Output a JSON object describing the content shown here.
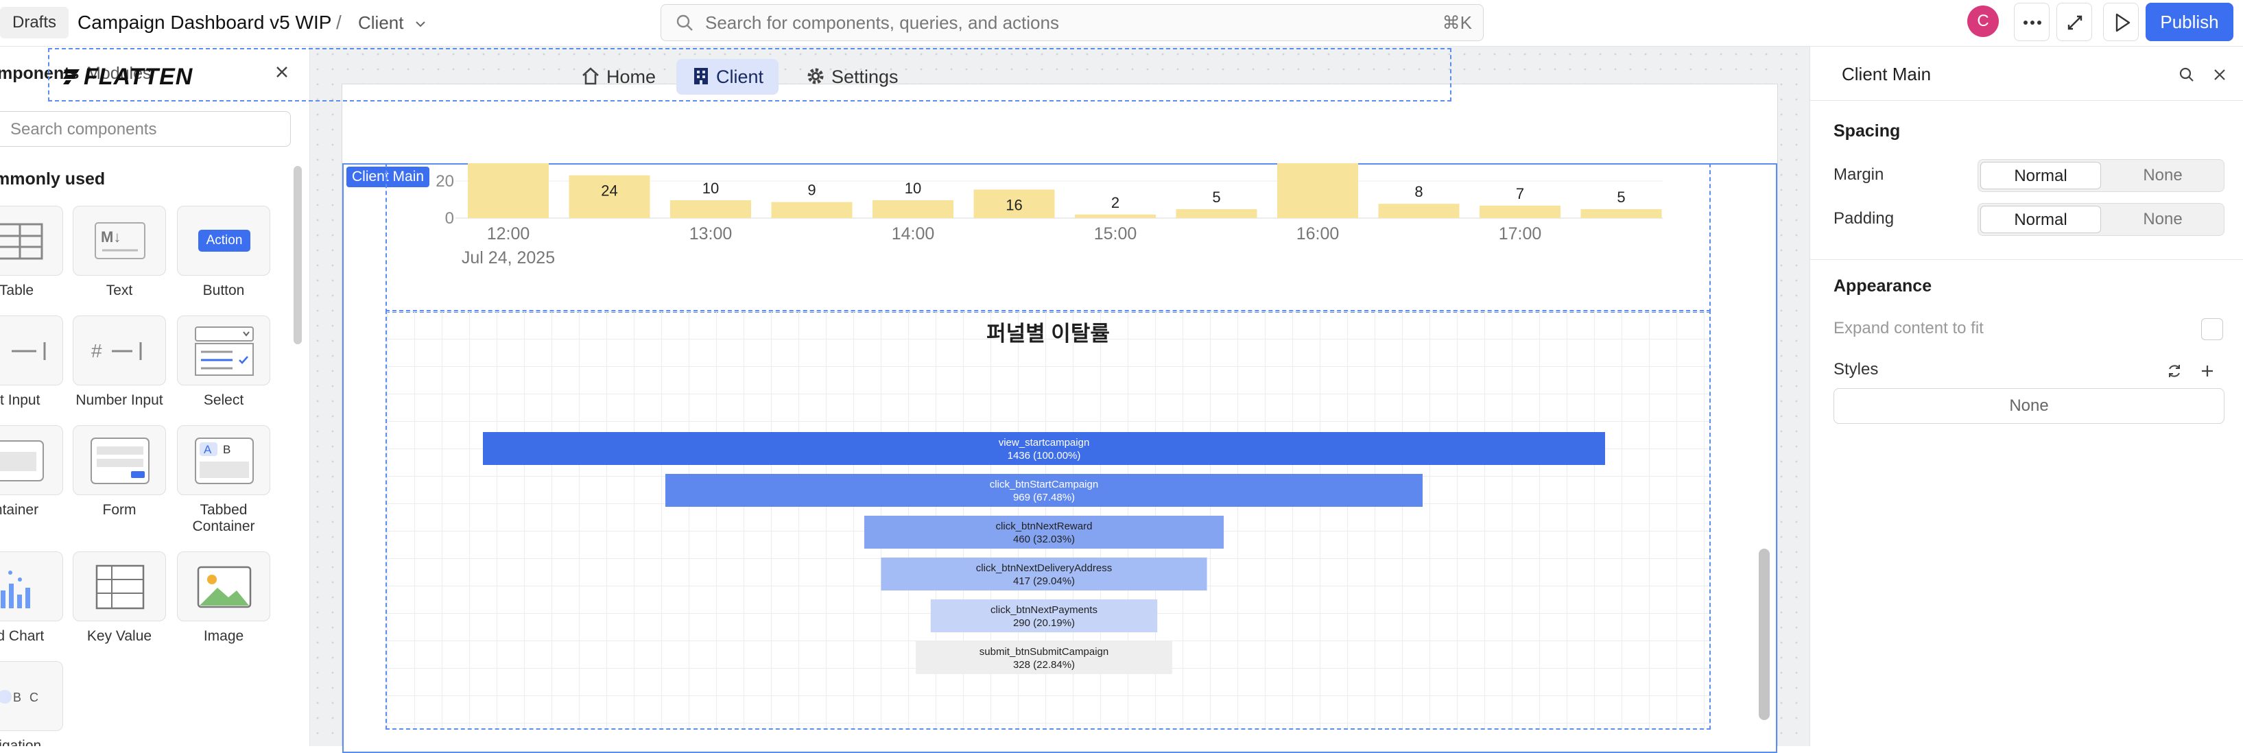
{
  "topbar": {
    "drafts": "Drafts",
    "app_name": "Campaign Dashboard v5 WIP",
    "separator": "/",
    "page": "Client",
    "search_placeholder": "Search for components, queries, and actions",
    "search_shortcut": "⌘K",
    "avatar_initial": "C",
    "publish": "Publish"
  },
  "left_panel": {
    "tabs": [
      "mponents",
      "Modules"
    ],
    "search_placeholder": "Search components",
    "section": "mmonly used",
    "components": [
      {
        "label": "Table",
        "icon": "table-icon"
      },
      {
        "label": "Text",
        "icon": "markdown-text-icon"
      },
      {
        "label": "Button",
        "icon": "button-icon",
        "badge": "Action"
      },
      {
        "label": "xt Input",
        "icon": "text-input-icon"
      },
      {
        "label": "Number Input",
        "icon": "number-input-icon"
      },
      {
        "label": "Select",
        "icon": "select-icon"
      },
      {
        "label": "ntainer",
        "icon": "container-icon"
      },
      {
        "label": "Form",
        "icon": "form-icon"
      },
      {
        "label": "Tabbed Container",
        "icon": "tabbed-container-icon",
        "badge_a": "A",
        "badge_b": "B"
      },
      {
        "label": "ed Chart",
        "icon": "chart-icon"
      },
      {
        "label": "Key Value",
        "icon": "key-value-icon"
      },
      {
        "label": "Image",
        "icon": "image-icon"
      },
      {
        "label": "vigation",
        "icon": "navigation-icon",
        "badge_b": "B",
        "badge_c": "C"
      }
    ]
  },
  "app_header": {
    "logo": "FLATTEN",
    "nav": [
      {
        "label": "Home",
        "icon": "home-icon"
      },
      {
        "label": "Client",
        "icon": "building-icon",
        "active": true
      },
      {
        "label": "Settings",
        "icon": "gear-icon"
      }
    ]
  },
  "main_badge": "Client Main",
  "funnel_title": "퍼널별 이탈률",
  "chart_data": [
    {
      "type": "bar",
      "y_tick_labels": [
        "20",
        "0"
      ],
      "x_tick_labels": [
        "12:00",
        "13:00",
        "14:00",
        "15:00",
        "16:00",
        "17:00"
      ],
      "x_sub_label": "Jul 24, 2025",
      "values": [
        null,
        24,
        10,
        9,
        10,
        16,
        2,
        5,
        null,
        8,
        7,
        5
      ],
      "data_labels": [
        "",
        "24",
        "10",
        "9",
        "10",
        "16",
        "2",
        "5",
        "",
        "8",
        "7",
        "5"
      ],
      "bar_color": "#f7e39a",
      "note": "first and ninth bars extend above visible area (clipped)"
    },
    {
      "type": "funnel",
      "title": "퍼널별 이탈률",
      "stages": [
        {
          "name": "view_startcampaign",
          "value": 1436,
          "label": "1436 (100.00%)",
          "color": "#3d6ee8"
        },
        {
          "name": "click_btnStartCampaign",
          "value": 969,
          "label": "969 (67.48%)",
          "color": "#5f88ee"
        },
        {
          "name": "click_btnNextReward",
          "value": 460,
          "label": "460 (32.03%)",
          "color": "#84a4f2"
        },
        {
          "name": "click_btnNextDeliveryAddress",
          "value": 417,
          "label": "417 (29.04%)",
          "color": "#a4bcf5"
        },
        {
          "name": "click_btnNextPayments",
          "value": 290,
          "label": "290 (20.19%)",
          "color": "#c6d4f8"
        },
        {
          "name": "submit_btnSubmitCampaign",
          "value": 328,
          "label": "328 (22.84%)",
          "color": "#eeeeee"
        }
      ]
    }
  ],
  "right_panel": {
    "title": "Client Main",
    "spacing": "Spacing",
    "margin": "Margin",
    "padding": "Padding",
    "normal": "Normal",
    "none": "None",
    "appearance": "Appearance",
    "expand": "Expand content to fit",
    "styles": "Styles",
    "styles_value": "None"
  }
}
